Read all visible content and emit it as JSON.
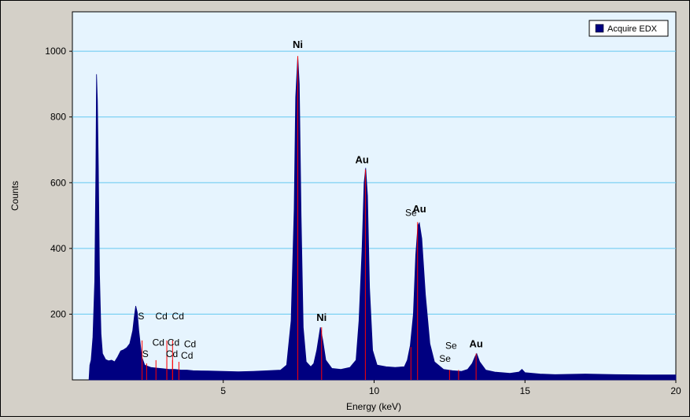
{
  "chart_data": {
    "type": "area",
    "xlabel": "Energy (keV)",
    "ylabel": "Counts",
    "xlim": [
      0,
      20
    ],
    "ylim": [
      0,
      1120
    ],
    "x_ticks": [
      5,
      10,
      15,
      20
    ],
    "y_ticks": [
      200,
      400,
      600,
      800,
      1000
    ],
    "grid": true,
    "legend_position": "top-right",
    "colors": {
      "fill": "#000080",
      "plot_bg": "#e6f4fe",
      "grid": "#64c8f0",
      "marker": "#ff0000"
    },
    "series": [
      {
        "name": "Acquire EDX",
        "points": [
          [
            0.55,
            0
          ],
          [
            0.58,
            45
          ],
          [
            0.62,
            60
          ],
          [
            0.68,
            130
          ],
          [
            0.74,
            300
          ],
          [
            0.78,
            650
          ],
          [
            0.8,
            930
          ],
          [
            0.83,
            850
          ],
          [
            0.86,
            650
          ],
          [
            0.9,
            320
          ],
          [
            0.95,
            140
          ],
          [
            1.0,
            80
          ],
          [
            1.1,
            62
          ],
          [
            1.2,
            58
          ],
          [
            1.3,
            60
          ],
          [
            1.4,
            55
          ],
          [
            1.5,
            70
          ],
          [
            1.6,
            88
          ],
          [
            1.7,
            92
          ],
          [
            1.8,
            98
          ],
          [
            1.9,
            110
          ],
          [
            2.0,
            150
          ],
          [
            2.05,
            190
          ],
          [
            2.1,
            225
          ],
          [
            2.15,
            205
          ],
          [
            2.2,
            150
          ],
          [
            2.3,
            70
          ],
          [
            2.4,
            45
          ],
          [
            2.6,
            38
          ],
          [
            2.8,
            36
          ],
          [
            3.0,
            34
          ],
          [
            3.2,
            32
          ],
          [
            3.4,
            32
          ],
          [
            3.6,
            30
          ],
          [
            3.8,
            30
          ],
          [
            4.0,
            28
          ],
          [
            4.5,
            27
          ],
          [
            5.0,
            26
          ],
          [
            5.5,
            25
          ],
          [
            6.0,
            26
          ],
          [
            6.5,
            28
          ],
          [
            6.9,
            30
          ],
          [
            7.1,
            45
          ],
          [
            7.25,
            180
          ],
          [
            7.35,
            520
          ],
          [
            7.4,
            860
          ],
          [
            7.47,
            985
          ],
          [
            7.52,
            900
          ],
          [
            7.58,
            500
          ],
          [
            7.65,
            160
          ],
          [
            7.75,
            55
          ],
          [
            7.9,
            40
          ],
          [
            8.0,
            50
          ],
          [
            8.1,
            90
          ],
          [
            8.22,
            160
          ],
          [
            8.3,
            120
          ],
          [
            8.4,
            60
          ],
          [
            8.6,
            35
          ],
          [
            8.9,
            32
          ],
          [
            9.2,
            38
          ],
          [
            9.4,
            60
          ],
          [
            9.5,
            180
          ],
          [
            9.6,
            400
          ],
          [
            9.67,
            600
          ],
          [
            9.72,
            645
          ],
          [
            9.78,
            560
          ],
          [
            9.85,
            280
          ],
          [
            9.95,
            90
          ],
          [
            10.1,
            45
          ],
          [
            10.4,
            40
          ],
          [
            10.7,
            38
          ],
          [
            11.0,
            40
          ],
          [
            11.1,
            60
          ],
          [
            11.2,
            105
          ],
          [
            11.3,
            200
          ],
          [
            11.38,
            380
          ],
          [
            11.45,
            470
          ],
          [
            11.5,
            478
          ],
          [
            11.58,
            430
          ],
          [
            11.7,
            260
          ],
          [
            11.85,
            110
          ],
          [
            12.0,
            55
          ],
          [
            12.3,
            32
          ],
          [
            12.6,
            28
          ],
          [
            12.9,
            26
          ],
          [
            13.1,
            32
          ],
          [
            13.25,
            50
          ],
          [
            13.35,
            72
          ],
          [
            13.4,
            80
          ],
          [
            13.5,
            55
          ],
          [
            13.7,
            30
          ],
          [
            14.0,
            24
          ],
          [
            14.5,
            20
          ],
          [
            14.8,
            24
          ],
          [
            14.9,
            32
          ],
          [
            15.0,
            22
          ],
          [
            15.5,
            18
          ],
          [
            16.0,
            16
          ],
          [
            17.0,
            18
          ],
          [
            18.0,
            16
          ],
          [
            19.0,
            15
          ],
          [
            20.0,
            15
          ]
        ]
      }
    ],
    "element_markers": [
      {
        "label": "S",
        "x": 2.31,
        "y": 120
      },
      {
        "label": "S",
        "x": 2.46,
        "y": 50
      },
      {
        "label": "Cd",
        "x": 3.13,
        "y": 120
      },
      {
        "label": "Cd",
        "x": 3.32,
        "y": 120
      },
      {
        "label": "Cd",
        "x": 2.77,
        "y": 60
      },
      {
        "label": "Cd",
        "x": 3.13,
        "y": 60
      },
      {
        "label": "Cd",
        "x": 3.32,
        "y": 60
      },
      {
        "label": "Cd",
        "x": 3.53,
        "y": 55
      },
      {
        "label": "Ni",
        "x": 7.47,
        "y": 985
      },
      {
        "label": "Ni",
        "x": 8.26,
        "y": 160
      },
      {
        "label": "Au",
        "x": 9.71,
        "y": 640
      },
      {
        "label": "Au",
        "x": 11.44,
        "y": 480
      },
      {
        "label": "Se",
        "x": 11.22,
        "y": 100
      },
      {
        "label": "Se",
        "x": 12.5,
        "y": 30
      },
      {
        "label": "Se",
        "x": 12.8,
        "y": 30
      },
      {
        "label": "Au",
        "x": 13.38,
        "y": 80
      }
    ],
    "peak_labels": [
      {
        "label": "Ni",
        "x": 7.47,
        "y": 1000,
        "bold": true
      },
      {
        "label": "Ni",
        "x": 8.26,
        "y": 170,
        "bold": true
      },
      {
        "label": "Au",
        "x": 9.6,
        "y": 650,
        "bold": true
      },
      {
        "label": "Au",
        "x": 11.5,
        "y": 500,
        "bold": true
      },
      {
        "label": "Au",
        "x": 13.38,
        "y": 90,
        "bold": true
      },
      {
        "label": "Se",
        "x": 11.22,
        "y": 490,
        "bold": false
      },
      {
        "label": "Se",
        "x": 12.55,
        "y": 85,
        "bold": false
      },
      {
        "label": "Se",
        "x": 12.35,
        "y": 45,
        "bold": false
      },
      {
        "label": "S",
        "x": 2.28,
        "y": 175,
        "bold": false
      },
      {
        "label": "S",
        "x": 2.42,
        "y": 60,
        "bold": false
      },
      {
        "label": "Cd",
        "x": 2.95,
        "y": 175,
        "bold": false
      },
      {
        "label": "Cd",
        "x": 3.5,
        "y": 175,
        "bold": false
      },
      {
        "label": "Cd",
        "x": 2.85,
        "y": 95,
        "bold": false
      },
      {
        "label": "Cd",
        "x": 3.35,
        "y": 95,
        "bold": false
      },
      {
        "label": "Cd",
        "x": 3.9,
        "y": 90,
        "bold": false
      },
      {
        "label": "Cd",
        "x": 3.3,
        "y": 60,
        "bold": false
      },
      {
        "label": "Cd",
        "x": 3.8,
        "y": 55,
        "bold": false
      }
    ]
  }
}
